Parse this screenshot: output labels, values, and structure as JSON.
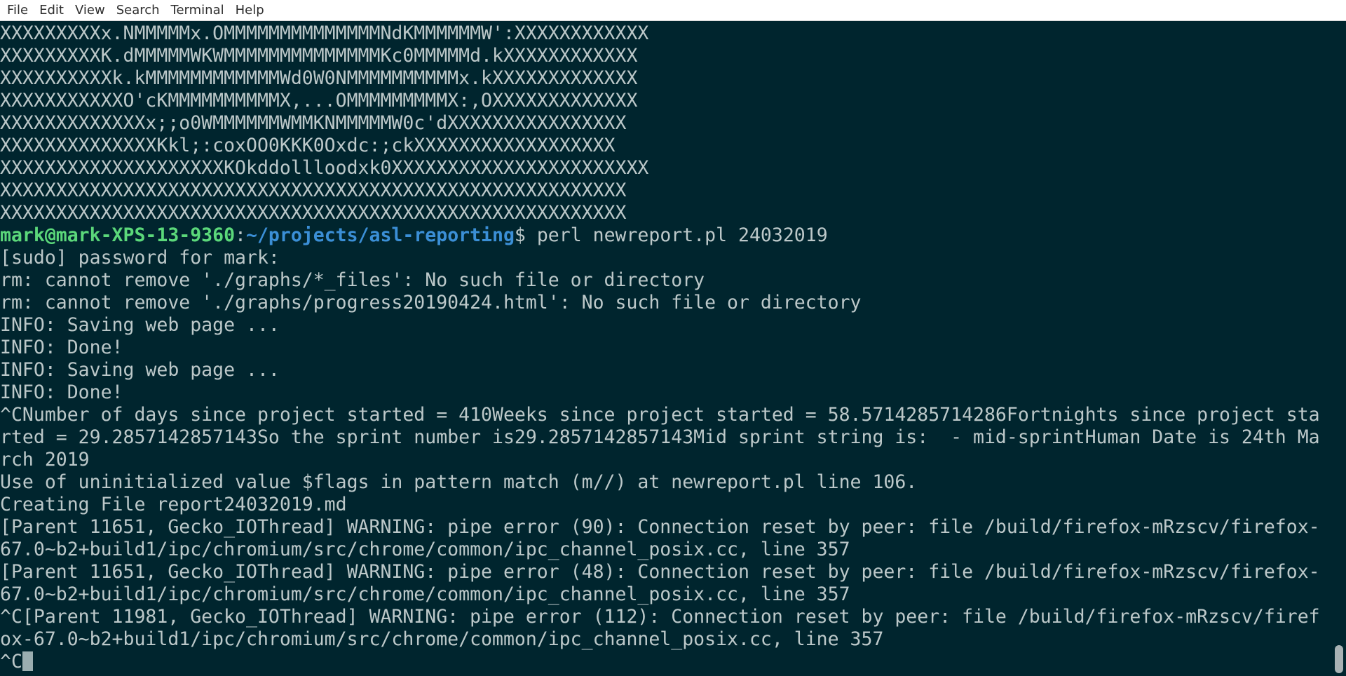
{
  "menu": {
    "items": [
      "File",
      "Edit",
      "View",
      "Search",
      "Terminal",
      "Help"
    ]
  },
  "terminal": {
    "banner": [
      "XXXXXXXXXx.NMMMMMx.OMMMMMMMMMMMMMMNdKMMMMMMW':XXXXXXXXXXXX",
      "XXXXXXXXXK.dMMMMMWKWMMMMMMMMMMMMMMKc0MMMMMd.kXXXXXXXXXXXX",
      "XXXXXXXXXXk.kMMMMMMMMMMMMWd0W0NMMMMMMMMMMx.kXXXXXXXXXXXXX",
      "XXXXXXXXXXXO'cKMMMMMMMMMMX,...OMMMMMMMMMX:,OXXXXXXXXXXXXX",
      "XXXXXXXXXXXXXx;;o0WMMMMMMWMMKNMMMMMW0c'dXXXXXXXXXXXXXXXX",
      "XXXXXXXXXXXXXXKkl;:coxOO0KKK0Oxdc:;ckXXXXXXXXXXXXXXXXXX",
      "XXXXXXXXXXXXXXXXXXXXKOkddollloodxk0XXXXXXXXXXXXXXXXXXXXXXX",
      "XXXXXXXXXXXXXXXXXXXXXXXXXXXXXXXXXXXXXXXXXXXXXXXXXXXXXXXX",
      "XXXXXXXXXXXXXXXXXXXXXXXXXXXXXXXXXXXXXXXXXXXXXXXXXXXXXXXX"
    ],
    "prompt": {
      "user": "mark@mark-XPS-13-9360",
      "path": "~/projects/asl-reporting",
      "symbol": "$",
      "command": " perl newreport.pl 24032019"
    },
    "output": [
      "[sudo] password for mark:",
      "rm: cannot remove './graphs/*_files': No such file or directory",
      "rm: cannot remove './graphs/progress20190424.html': No such file or directory",
      "INFO: Saving web page ...",
      "INFO: Done!",
      "INFO: Saving web page ...",
      "INFO: Done!",
      "^CNumber of days since project started = 410Weeks since project started = 58.5714285714286Fortnights since project sta",
      "rted = 29.2857142857143So the sprint number is29.2857142857143Mid sprint string is:  - mid-sprintHuman Date is 24th Ma",
      "rch 2019",
      "Use of uninitialized value $flags in pattern match (m//) at newreport.pl line 106.",
      "Creating File report24032019.md",
      "[Parent 11651, Gecko_IOThread] WARNING: pipe error (90): Connection reset by peer: file /build/firefox-mRzscv/firefox-",
      "67.0~b2+build1/ipc/chromium/src/chrome/common/ipc_channel_posix.cc, line 357",
      "[Parent 11651, Gecko_IOThread] WARNING: pipe error (48): Connection reset by peer: file /build/firefox-mRzscv/firefox-",
      "67.0~b2+build1/ipc/chromium/src/chrome/common/ipc_channel_posix.cc, line 357",
      "^C[Parent 11981, Gecko_IOThread] WARNING: pipe error (112): Connection reset by peer: file /build/firefox-mRzscv/firef",
      "ox-67.0~b2+build1/ipc/chromium/src/chrome/common/ipc_channel_posix.cc, line 357"
    ],
    "current_input": "^C"
  },
  "colors": {
    "background": "#00252e",
    "text": "#bcc8c9",
    "prompt_user": "#5bd87a",
    "prompt_path": "#3b8fd6"
  }
}
